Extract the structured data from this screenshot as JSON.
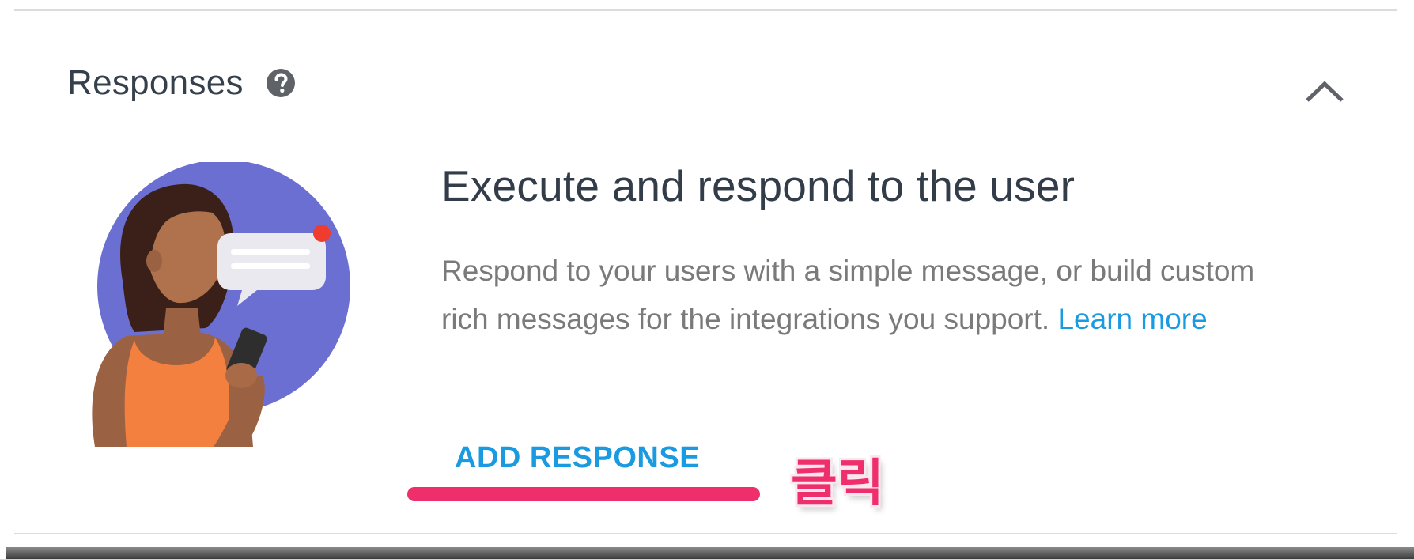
{
  "section": {
    "title": "Responses",
    "help_icon": "question-mark-circle-icon",
    "collapse_icon": "chevron-up-icon"
  },
  "content": {
    "heading": "Execute and respond to the user",
    "description": "Respond to your users with a simple message, or build custom rich messages for the integrations you support.",
    "learn_more": "Learn more"
  },
  "actions": {
    "add_response_label": "ADD RESPONSE"
  },
  "annotation": {
    "label": "클릭",
    "color": "#ee2f6c"
  },
  "colors": {
    "accent": "#1a9ae0",
    "illustration_circle": "#6b6fd1"
  }
}
